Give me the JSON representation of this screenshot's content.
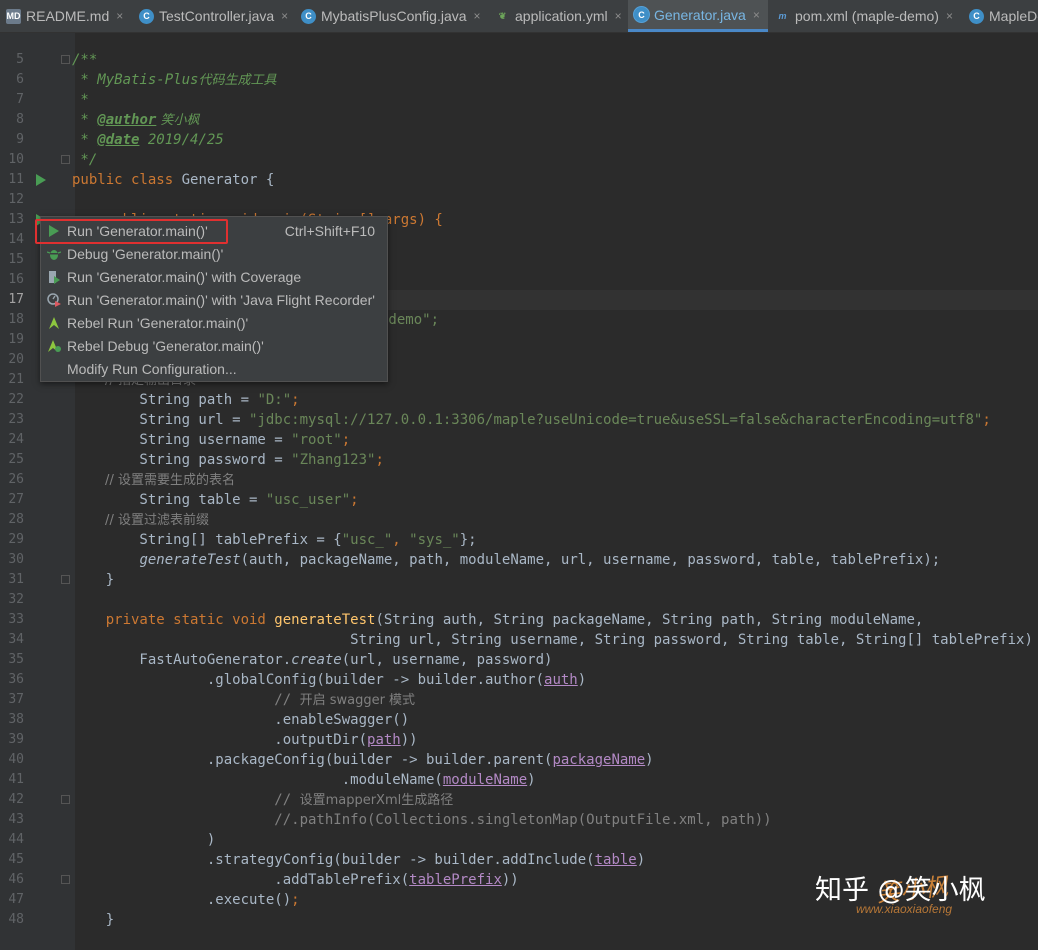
{
  "tabs": [
    {
      "label": "README.md",
      "icon": "markdown-file-icon",
      "active": false
    },
    {
      "label": "TestController.java",
      "icon": "java-class-icon",
      "active": false
    },
    {
      "label": "MybatisPlusConfig.java",
      "icon": "java-class-icon",
      "active": false
    },
    {
      "label": "application.yml",
      "icon": "yaml-file-icon",
      "active": false
    },
    {
      "label": "Generator.java",
      "icon": "java-class-icon",
      "active": true
    },
    {
      "label": "pom.xml (maple-demo)",
      "icon": "maven-icon",
      "active": false
    },
    {
      "label": "MapleDe",
      "icon": "java-class-icon",
      "active": false
    }
  ],
  "close_glyph": "×",
  "line_numbers": [
    "5",
    "6",
    "7",
    "8",
    "9",
    "10",
    "11",
    "12",
    "13",
    "14",
    "15",
    "16",
    "17",
    "18",
    "19",
    "20",
    "21",
    "22",
    "23",
    "24",
    "25",
    "26",
    "27",
    "28",
    "29",
    "30",
    "31",
    "32",
    "33",
    "34",
    "35",
    "36",
    "37",
    "38",
    "39",
    "40",
    "41",
    "42",
    "43",
    "44",
    "45",
    "46",
    "47",
    "48"
  ],
  "current_line": "17",
  "code": {
    "l5": "/**",
    "l6_a": " * MyBatis-Plus",
    "l6_b": "代码生成工具",
    "l7": " *",
    "l8_a": " * ",
    "l8_tag": "@author",
    "l8_b": " 笑小枫",
    "l9_a": " * ",
    "l9_tag": "@date",
    "l9_b": " 2019/4/25",
    "l10": " */",
    "l11_kw": "public class",
    "l11_b": " Generator {",
    "l13_a": "    public static void main(String[] args) {",
    "l18_tail": ".demo\";",
    "l21": "        // 指定输出目录",
    "l22_a": "        String path = ",
    "l22_s": "\"D:\"",
    "l23_a": "        String url = ",
    "l23_s": "\"jdbc:mysql://127.0.0.1:3306/maple?useUnicode=true&useSSL=false&characterEncoding=utf8\"",
    "l24_a": "        String username = ",
    "l24_s": "\"root\"",
    "l25_a": "        String password = ",
    "l25_s": "\"Zhang123\"",
    "l26": "        // 设置需要生成的表名",
    "l27_a": "        String table = ",
    "l27_s": "\"usc_user\"",
    "l28": "        // 设置过滤表前缀",
    "l29_a": "        String[] tablePrefix = {",
    "l29_s1": "\"usc_\"",
    "l29_c": ", ",
    "l29_s2": "\"sys_\"",
    "l29_e": "};",
    "l30_m": "generateTest",
    "l30_b": "(auth, packageName, path, moduleName, url, username, password, table, tablePrefix);",
    "l31": "    }",
    "l33_kw": "private static void ",
    "l33_m": "generateTest",
    "l33_b": "(String auth, String packageName, String path, String moduleName,",
    "l34": "                                 String url, String username, String password, String table, String[] tablePrefix) {",
    "l35_a": "        FastAutoGenerator.",
    "l35_m": "create",
    "l35_b": "(url, username, password)",
    "l36_a": "                .globalConfig(builder -> builder.author(",
    "l36_p": "auth",
    "l36_b": ")",
    "l37_a": "                        // ",
    "l37_b": "开启 swagger 模式",
    "l38": "                        .enableSwagger()",
    "l39_a": "                        .outputDir(",
    "l39_p": "path",
    "l39_b": "))",
    "l40_a": "                .packageConfig(builder -> builder.parent(",
    "l40_p": "packageName",
    "l40_b": ")",
    "l41_a": "                                .moduleName(",
    "l41_p": "moduleName",
    "l41_b": ")",
    "l42_a": "                        // ",
    "l42_b": "设置mapperXml生成路径",
    "l43": "                        //.pathInfo(Collections.singletonMap(OutputFile.xml, path))",
    "l44": "                )",
    "l45_a": "                .strategyConfig(builder -> builder.addInclude(",
    "l45_p": "table",
    "l45_b": ")",
    "l46_a": "                        .addTablePrefix(",
    "l46_p": "tablePrefix",
    "l46_b": "))",
    "l47_a": "                .execute()",
    "l47_b": ";",
    "l48": "    }"
  },
  "context_menu": {
    "items": [
      {
        "label": "Run 'Generator.main()'",
        "shortcut": "Ctrl+Shift+F10",
        "icon": "run-icon"
      },
      {
        "label": "Debug 'Generator.main()'",
        "icon": "debug-icon"
      },
      {
        "label": "Run 'Generator.main()' with Coverage",
        "icon": "coverage-icon"
      },
      {
        "label": "Run 'Generator.main()' with 'Java Flight Recorder'",
        "icon": "flight-recorder-icon"
      },
      {
        "label": "Rebel Run 'Generator.main()'",
        "icon": "jrebel-run-icon"
      },
      {
        "label": "Rebel Debug 'Generator.main()'",
        "icon": "jrebel-debug-icon"
      },
      {
        "label": "Modify Run Configuration...",
        "icon": ""
      }
    ]
  },
  "watermark": {
    "text": "知乎 @笑小枫",
    "seal": "笑小枫",
    "url": "www.xiaoxiaofeng"
  },
  "colors": {
    "editor_bg": "#2b2b2b",
    "gutter_bg": "#313335",
    "keyword": "#cc7832",
    "string": "#6a8759",
    "highlight_box": "#e03030"
  }
}
